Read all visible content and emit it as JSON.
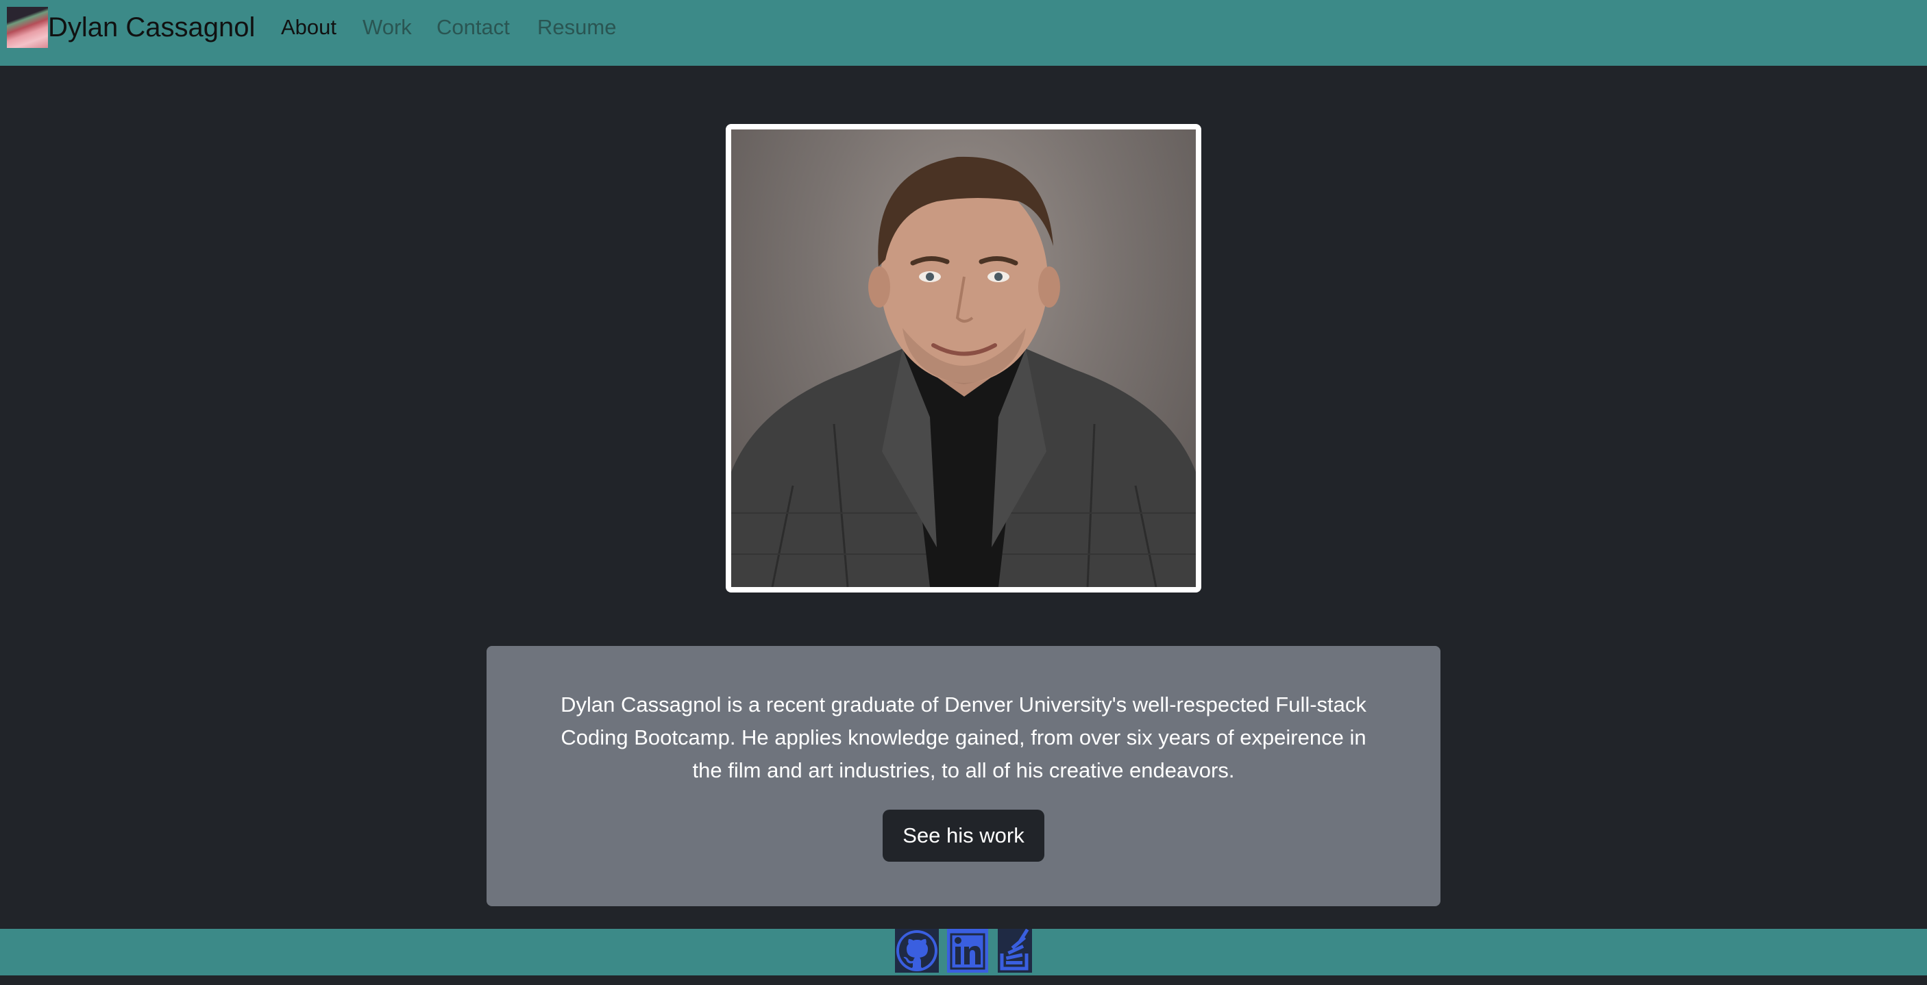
{
  "header": {
    "brand_name": "Dylan Cassagnol",
    "nav": [
      {
        "label": "About",
        "active": true
      },
      {
        "label": "Work",
        "active": false
      },
      {
        "label": "Contact",
        "active": false
      },
      {
        "label": "Resume",
        "active": false
      }
    ]
  },
  "about": {
    "bio_line_1": "Dylan Cassagnol is a recent graduate of Denver University's well-respected Full-stack",
    "bio_line_2": "Coding Bootcamp. He applies knowledge gained, from over six years of expeirence in",
    "bio_line_3": "the film and art industries, to all of his creative endeavors.",
    "cta_label": "See his work"
  },
  "footer": {
    "icons": [
      "github-icon",
      "linkedin-icon",
      "stackoverflow-icon"
    ]
  },
  "colors": {
    "navbar": "#3c8a88",
    "page_background": "#212429",
    "card_background": "#6f747d",
    "social_icon": "#3a5fe0"
  }
}
